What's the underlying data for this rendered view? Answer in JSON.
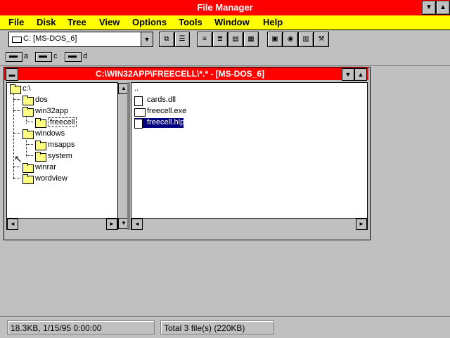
{
  "app": {
    "title": "File Manager"
  },
  "menu": [
    {
      "label": "File"
    },
    {
      "label": "Disk"
    },
    {
      "label": "Tree"
    },
    {
      "label": "View"
    },
    {
      "label": "Options"
    },
    {
      "label": "Tools"
    },
    {
      "label": "Window"
    },
    {
      "label": "Help"
    }
  ],
  "toolbar": {
    "drive_select": "C: [MS-DOS_6]"
  },
  "drives": [
    {
      "letter": "a"
    },
    {
      "letter": "c"
    },
    {
      "letter": "d"
    }
  ],
  "child_window": {
    "title": "C:\\WIN32APP\\FREECELL\\*.* - [MS-DOS_6]"
  },
  "tree": [
    {
      "label": "c:\\",
      "indent": 0
    },
    {
      "label": "dos",
      "indent": 1
    },
    {
      "label": "win32app",
      "indent": 1
    },
    {
      "label": "freecell",
      "indent": 2,
      "selected": true
    },
    {
      "label": "windows",
      "indent": 1
    },
    {
      "label": "msapps",
      "indent": 2
    },
    {
      "label": "system",
      "indent": 2
    },
    {
      "label": "winrar",
      "indent": 1
    },
    {
      "label": "wordview",
      "indent": 1
    }
  ],
  "files": [
    {
      "name": "..",
      "type": "up"
    },
    {
      "name": "cards.dll",
      "type": "dll"
    },
    {
      "name": "freecell.exe",
      "type": "exe"
    },
    {
      "name": "freecell.hlp",
      "type": "hlp",
      "selected": true
    }
  ],
  "status": {
    "left": "18.3KB, 1/15/95 0:00:00",
    "right": "Total 3 file(s) (220KB)"
  },
  "colors": {
    "title_bar": "#ff0000",
    "menu_bar": "#ffff00",
    "desktop": "#c0c0c0",
    "selection": "#000080"
  }
}
